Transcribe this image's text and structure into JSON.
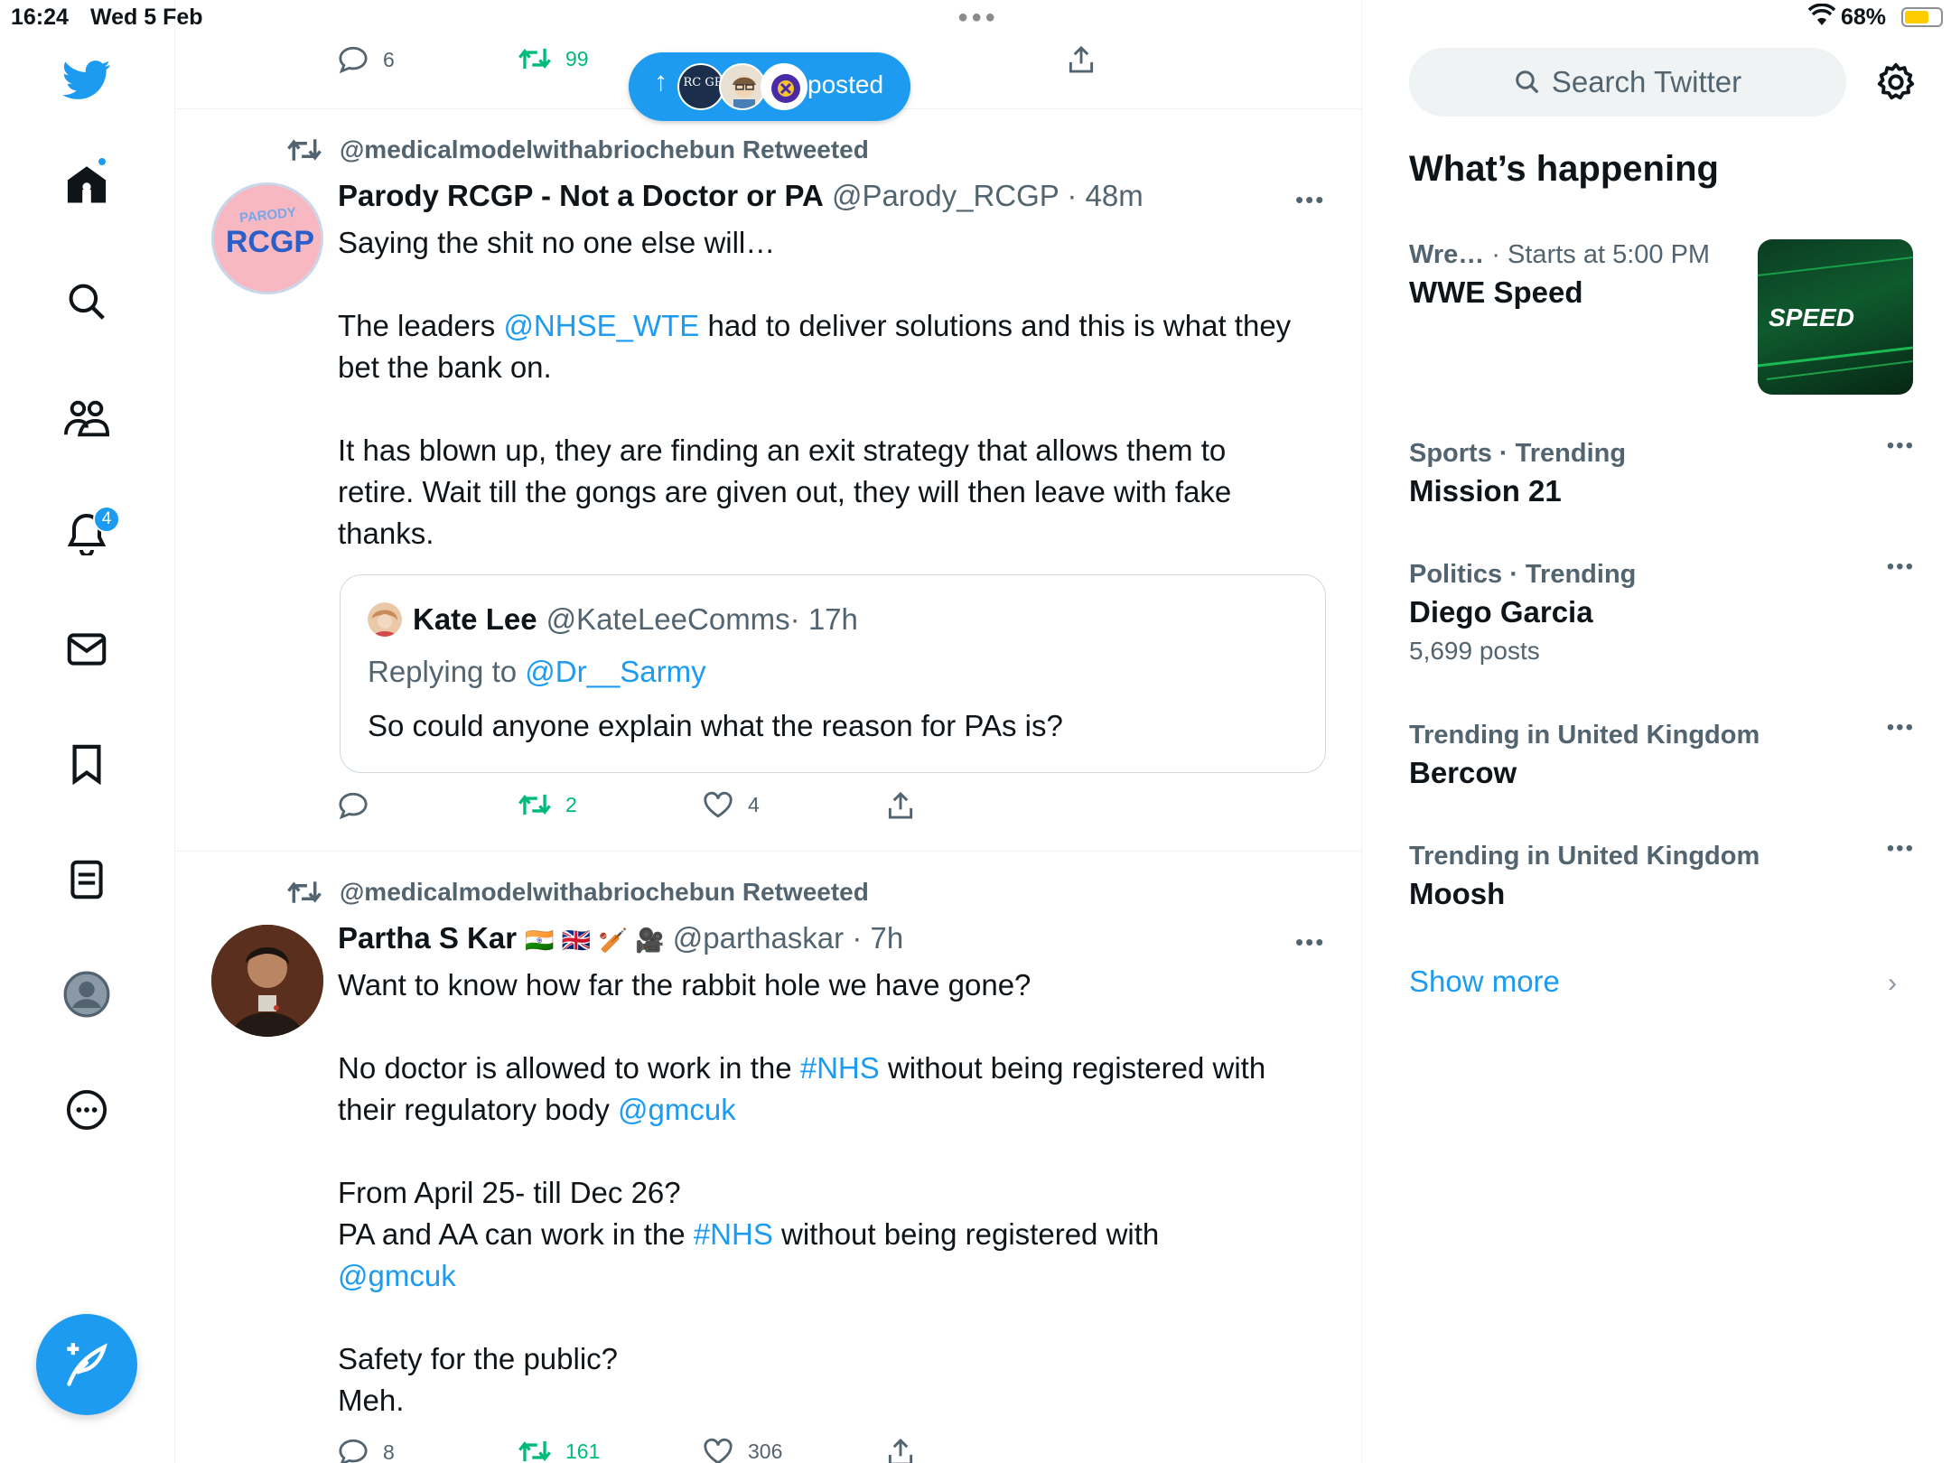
{
  "status_bar": {
    "time": "16:24",
    "date": "Wed 5 Feb",
    "battery": "68%"
  },
  "nav": {
    "notifications_badge": "4"
  },
  "top_tweet": {
    "replies": "6",
    "retweets": "99"
  },
  "posted_pill": {
    "label": "posted",
    "avatar_1_text": "RC GP"
  },
  "tweets": [
    {
      "retweeted_by": "@medicalmodelwithabriochebun Retweeted",
      "name": "Parody RCGP - Not a Doctor or PA",
      "handle": "@Parody_RCGP",
      "time": "· 48m",
      "avatar_text_top": "PARODY",
      "avatar_text_main": "RCGP",
      "body": {
        "l1": "Saying the shit no one else will…",
        "l3a": "The leaders ",
        "l3link": "@NHSE_WTE",
        "l3b": " had to deliver solutions and this is what they",
        "l4": "bet the bank on.",
        "l6": "It has blown up, they are finding an exit strategy that allows them to",
        "l7": "retire. Wait till the gongs are given out, they will then leave with fake",
        "l8": "thanks."
      },
      "quote": {
        "name": "Kate Lee",
        "handle": "@KateLeeComms",
        "time": "· 17h",
        "replying": "Replying to ",
        "replying_link": "@Dr__Sarmy",
        "text": "So could anyone explain what the reason for PAs is?"
      },
      "replies": "",
      "retweets": "2",
      "likes": "4"
    },
    {
      "retweeted_by": "@medicalmodelwithabriochebun Retweeted",
      "name": "Partha S Kar",
      "emojis": "🇮🇳 🇬🇧 🏏 🎥",
      "handle": "@parthaskar",
      "time": "· 7h",
      "body": {
        "l1": "Want to know how far the rabbit hole we have gone?",
        "l3a": "No doctor is allowed to work in the ",
        "l3link": "#NHS",
        "l3b": " without being registered with",
        "l4a": "their regulatory body ",
        "l4link": "@gmcuk",
        "l6": "From April 25- till Dec 26?",
        "l7a": "PA and AA can work in the ",
        "l7link": "#NHS",
        "l7b": " without being registered with",
        "l8link": "@gmcuk",
        "l10": "Safety for the public?",
        "l11": "Meh."
      },
      "replies": "8",
      "retweets": "161",
      "likes": "306"
    }
  ],
  "right": {
    "search_placeholder": "Search Twitter",
    "heading": "What’s happening",
    "trends": [
      {
        "ctx_a": "Wre…",
        "ctx_b": " · Starts at 5:00 PM",
        "title": "WWE Speed",
        "image_text": "SPEED"
      },
      {
        "ctx_a": "Sports",
        "ctx_b": " · Trending",
        "title": "Mission 21"
      },
      {
        "ctx_a": "Politics",
        "ctx_b": " · Trending",
        "title": "Diego Garcia",
        "count": "5,699 posts"
      },
      {
        "ctx_a": "Trending in United Kingdom",
        "ctx_b": "",
        "title": "Bercow"
      },
      {
        "ctx_a": "Trending in United Kingdom",
        "ctx_b": "",
        "title": "Moosh"
      }
    ],
    "show_more": "Show more"
  },
  "colors": {
    "accent": "#1d9bf0",
    "retweet_green": "#00ba7c",
    "secondary_text": "#536471",
    "border": "#eff3f4"
  }
}
